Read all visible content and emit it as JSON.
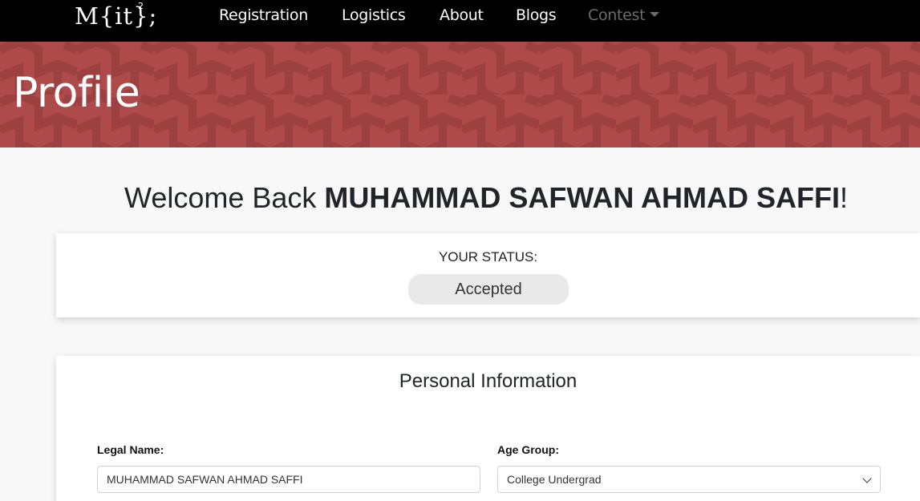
{
  "nav": {
    "logo_text": "M{it};",
    "logo_superscript": "2",
    "items": [
      {
        "label": "Registration"
      },
      {
        "label": "Logistics"
      },
      {
        "label": "About"
      },
      {
        "label": "Blogs"
      },
      {
        "label": "Contest",
        "icon": "caret-down-icon"
      }
    ]
  },
  "banner": {
    "title": "Profile",
    "background_color": "#ae4a4a"
  },
  "welcome": {
    "prefix": "Welcome Back ",
    "name": "MUHAMMAD SAFWAN AHMAD SAFFI",
    "suffix": "!"
  },
  "status": {
    "label": "YOUR STATUS:",
    "value": "Accepted"
  },
  "personal_info": {
    "title": "Personal Information",
    "fields": [
      {
        "label": "Legal Name:",
        "value": "MUHAMMAD SAFWAN AHMAD SAFFI"
      },
      {
        "label": "Age Group:",
        "value": "College Undergrad"
      }
    ]
  }
}
